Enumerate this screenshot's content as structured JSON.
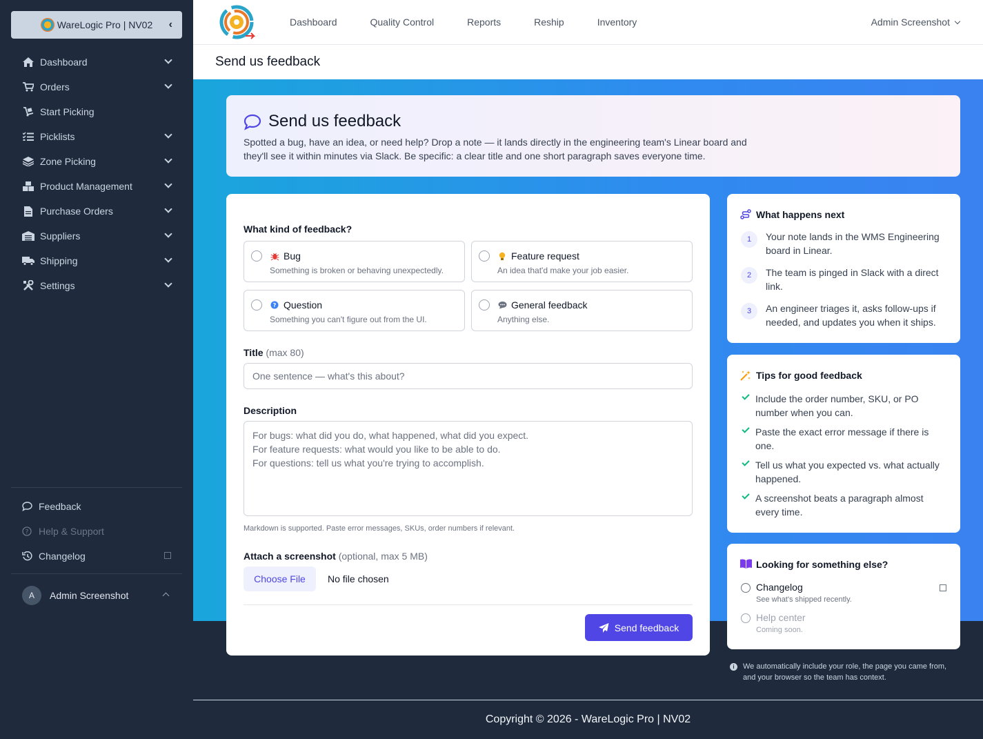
{
  "sidebar": {
    "brand": "WareLogic Pro | NV02",
    "items": [
      {
        "label": "Dashboard",
        "icon": "home-icon"
      },
      {
        "label": "Orders",
        "icon": "cart-icon"
      },
      {
        "label": "Start Picking",
        "icon": "dolly-icon"
      },
      {
        "label": "Picklists",
        "icon": "list-check-icon"
      },
      {
        "label": "Zone Picking",
        "icon": "layers-icon"
      },
      {
        "label": "Product Management",
        "icon": "boxes-icon"
      },
      {
        "label": "Purchase Orders",
        "icon": "file-icon"
      },
      {
        "label": "Suppliers",
        "icon": "warehouse-icon"
      },
      {
        "label": "Shipping",
        "icon": "truck-icon"
      },
      {
        "label": "Settings",
        "icon": "tools-icon"
      }
    ],
    "bottom": {
      "feedback": "Feedback",
      "help": "Help & Support",
      "changelog": "Changelog"
    },
    "user": {
      "initial": "A",
      "name": "Admin Screenshot"
    }
  },
  "topbar": {
    "nav": [
      "Dashboard",
      "Quality Control",
      "Reports",
      "Reship",
      "Inventory"
    ],
    "user": "Admin Screenshot"
  },
  "page": {
    "title": "Send us feedback"
  },
  "hero": {
    "title": "Send us feedback",
    "body": "Spotted a bug, have an idea, or need help? Drop a note — it lands directly in the engineering team's Linear board and they'll see it within minutes via Slack. Be specific: a clear title and one short paragraph saves everyone time."
  },
  "form": {
    "kind_label": "What kind of feedback?",
    "options": [
      {
        "title": "Bug",
        "desc": "Something is broken or behaving unexpectedly."
      },
      {
        "title": "Feature request",
        "desc": "An idea that'd make your job easier."
      },
      {
        "title": "Question",
        "desc": "Something you can't figure out from the UI."
      },
      {
        "title": "General feedback",
        "desc": "Anything else."
      }
    ],
    "title_label": "Title",
    "title_hint": "(max 80)",
    "title_placeholder": "One sentence — what's this about?",
    "desc_label": "Description",
    "desc_placeholder": "For bugs: what did you do, what happened, what did you expect.\nFor feature requests: what would you like to be able to do.\nFor questions: tell us what you're trying to accomplish.",
    "desc_help": "Markdown is supported. Paste error messages, SKUs, order numbers if relevant.",
    "attach_label": "Attach a screenshot",
    "attach_hint": "(optional, max 5 MB)",
    "choose_file": "Choose File",
    "no_file": "No file chosen",
    "submit": "Send feedback"
  },
  "next": {
    "title": "What happens next",
    "steps": [
      {
        "n": "1",
        "text": "Your note lands in the WMS Engineering board in Linear."
      },
      {
        "n": "2",
        "text": "The team is pinged in Slack with a direct link."
      },
      {
        "n": "3",
        "text": "An engineer triages it, asks follow-ups if needed, and updates you when it ships."
      }
    ]
  },
  "tips": {
    "title": "Tips for good feedback",
    "items": [
      "Include the order number, SKU, or PO number when you can.",
      "Paste the exact error message if there is one.",
      "Tell us what you expected vs. what actually happened.",
      "A screenshot beats a paragraph almost every time."
    ]
  },
  "else": {
    "title": "Looking for something else?",
    "links": [
      {
        "title": "Changelog",
        "desc": "See what's shipped recently."
      },
      {
        "title": "Help center",
        "desc": "Coming soon."
      }
    ]
  },
  "auto_note": "We automatically include your role, the page you came from, and your browser so the team has context.",
  "copyright": "Copyright © 2026 - WareLogic Pro | NV02",
  "colors": {
    "accent": "#4f46e5",
    "sidebar": "#1f2a3c",
    "success": "#10b981"
  }
}
